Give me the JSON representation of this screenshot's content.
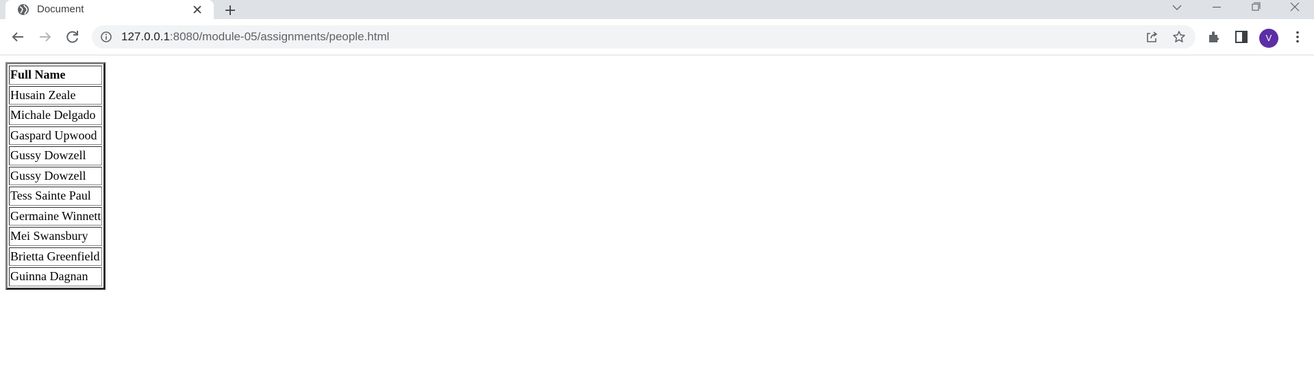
{
  "browser": {
    "tab_title": "Document",
    "url_host": "127.0.0.1",
    "url_rest": ":8080/module-05/assignments/people.html",
    "profile_initial": "V",
    "profile_color": "#5b2ea6",
    "icons": [
      "globe-icon",
      "close-icon",
      "plus-icon",
      "chevron-down-icon",
      "minimize-icon",
      "restore-icon",
      "window-close-icon",
      "back-icon",
      "forward-icon",
      "reload-icon",
      "info-icon",
      "share-icon",
      "star-icon",
      "extensions-icon",
      "side-panel-icon",
      "kebab-menu-icon"
    ]
  },
  "table": {
    "header": "Full Name",
    "rows": [
      "Husain Zeale",
      "Michale Delgado",
      "Gaspard Upwood",
      "Gussy Dowzell",
      "Gussy Dowzell",
      "Tess Sainte Paul",
      "Germaine Winnett",
      "Mei Swansbury",
      "Brietta Greenfield",
      "Guinna Dagnan"
    ]
  }
}
